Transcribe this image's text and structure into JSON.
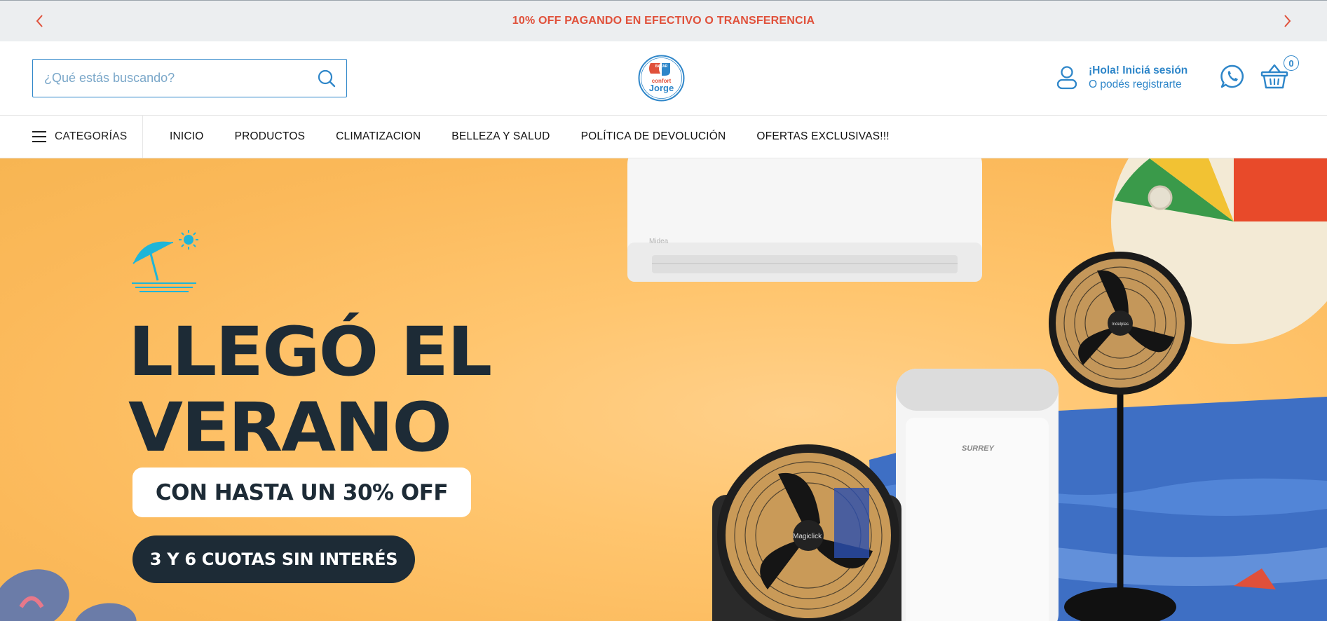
{
  "announcement": {
    "message": "10% OFF PAGANDO EN EFECTIVO O TRANSFERENCIA",
    "prev_icon": "chevron-left-icon",
    "next_icon": "chevron-right-icon",
    "accent": "#e0503a"
  },
  "header": {
    "search": {
      "placeholder": "¿Qué estás buscando?",
      "value": "",
      "icon": "search-icon"
    },
    "logo": {
      "line1": "BAZAR",
      "line2": "confort",
      "line3": "Jorge"
    },
    "account": {
      "greeting": "¡Hola! Iniciá sesión",
      "sub": "O podés registrarte",
      "icon": "user-icon"
    },
    "whatsapp_icon": "whatsapp-icon",
    "cart": {
      "icon": "basket-icon",
      "count": "0"
    },
    "accent": "#2e86c9"
  },
  "nav": {
    "categories_label": "CATEGORÍAS",
    "items": [
      {
        "label": "INICIO"
      },
      {
        "label": "PRODUCTOS"
      },
      {
        "label": "CLIMATIZACION"
      },
      {
        "label": "BELLEZA Y SALUD"
      },
      {
        "label": "POLÍTICA DE DEVOLUCIÓN"
      },
      {
        "label": "OFERTAS EXCLUSIVAS!!!"
      }
    ]
  },
  "hero": {
    "title_line1": "LLEGÓ EL",
    "title_line2": "VERANO",
    "badge1": "CON HASTA UN 30% OFF",
    "badge2": "3 Y 6 CUOTAS SIN INTERÉS",
    "ac_brand": "Midea",
    "portable_brand": "SURREY",
    "fan1_brand": "Magiclick",
    "fan2_brand": "Indelplas",
    "background_color": "#fbb95a",
    "dark_color": "#1d2b36"
  }
}
